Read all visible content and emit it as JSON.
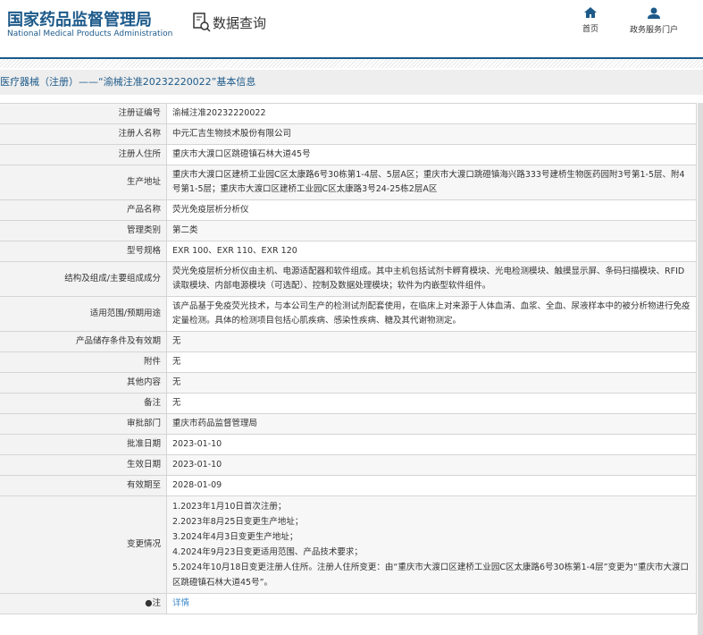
{
  "header": {
    "logo_cn": "国家药品监督管理局",
    "logo_en": "National Medical Products Administration",
    "section": "数据查询",
    "nav": [
      {
        "label": "首页",
        "icon": "home-icon"
      },
      {
        "label": "政务服务门户",
        "icon": "user-icon"
      }
    ]
  },
  "breadcrumb": "医疗器械（注册）——“渝械注准20232220022”基本信息",
  "rows": [
    {
      "label": "注册证编号",
      "value": "渝械注准20232220022"
    },
    {
      "label": "注册人名称",
      "value": "中元汇吉生物技术股份有限公司"
    },
    {
      "label": "注册人住所",
      "value": "重庆市大渡口区跳磴镇石林大道45号"
    },
    {
      "label": "生产地址",
      "value": "重庆市大渡口区建桥工业园C区太康路6号30栋第1-4层、5层A区；重庆市大渡口跳磴镇海兴路333号建桥生物医药园附3号第1-5层、附4号第1-5层；重庆市大渡口区建桥工业园C区太康路3号24-25栋2层A区"
    },
    {
      "label": "产品名称",
      "value": "荧光免疫层析分析仪"
    },
    {
      "label": "管理类别",
      "value": "第二类"
    },
    {
      "label": "型号规格",
      "value": "EXR 100、EXR 110、EXR 120"
    },
    {
      "label": "结构及组成/主要组成成分",
      "value": "荧光免疫层析分析仪由主机、电源适配器和软件组成。其中主机包括试剂卡孵育模块、光电检测模块、触摸显示屏、条码扫描模块、RFID读取模块、内部电源模块（可选配）、控制及数据处理模块；软件为内嵌型软件组件。"
    },
    {
      "label": "适用范围/预期用途",
      "value": "该产品基于免疫荧光技术，与本公司生产的检测试剂配套使用，在临床上对来源于人体血清、血浆、全血、尿液样本中的被分析物进行免疫定量检测。具体的检测项目包括心肌疾病、感染性疾病、糖及其代谢物测定。"
    },
    {
      "label": "产品储存条件及有效期",
      "value": "无"
    },
    {
      "label": "附件",
      "value": "无"
    },
    {
      "label": "其他内容",
      "value": "无"
    },
    {
      "label": "备注",
      "value": "无"
    },
    {
      "label": "审批部门",
      "value": "重庆市药品监督管理局"
    },
    {
      "label": "批准日期",
      "value": "2023-01-10"
    },
    {
      "label": "生效日期",
      "value": "2023-01-10"
    },
    {
      "label": "有效期至",
      "value": "2028-01-09"
    }
  ],
  "changes": {
    "label": "变更情况",
    "items": [
      "1.2023年1月10日首次注册；",
      "2.2023年8月25日变更生产地址；",
      "3.2024年4月3日变更生产地址；",
      "4.2024年9月23日变更适用范围、产品技术要求；",
      "5.2024年10月18日变更注册人住所。注册人住所变更：由“重庆市大渡口区建桥工业园C区太康路6号30栋第1-4层”变更为“重庆市大渡口区跳磴镇石林大道45号”。"
    ]
  },
  "note": {
    "label": "注",
    "link": "详情"
  }
}
